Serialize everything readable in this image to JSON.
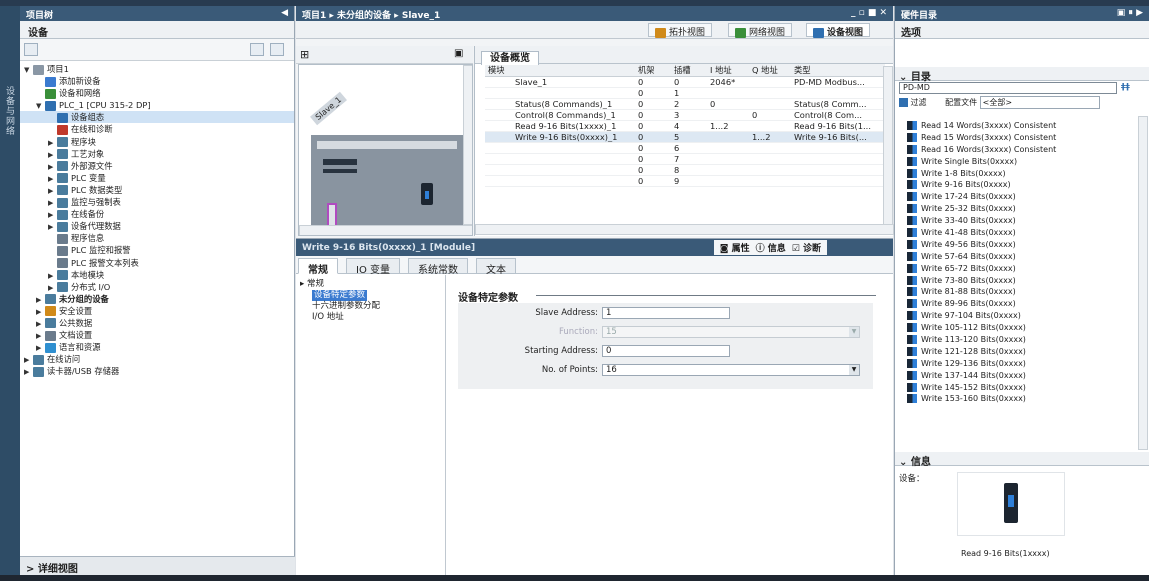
{
  "project_tree": {
    "panel_title": "项目树",
    "tab": "设备",
    "vertical_tab": "设备与网络",
    "items": [
      {
        "label": "项目1",
        "indent": 0,
        "arrow": "▼",
        "icon": "#8a97a5"
      },
      {
        "label": "添加新设备",
        "indent": 1,
        "arrow": "",
        "icon": "#3b7bd0"
      },
      {
        "label": "设备和网络",
        "indent": 1,
        "arrow": "",
        "icon": "#3a8f3a"
      },
      {
        "label": "PLC_1 [CPU 315-2 DP]",
        "indent": 1,
        "arrow": "▼",
        "icon": "#2f6fb0"
      },
      {
        "label": "设备组态",
        "indent": 2,
        "arrow": "",
        "icon": "#2f6fb0",
        "selected": true
      },
      {
        "label": "在线和诊断",
        "indent": 2,
        "arrow": "",
        "icon": "#c0392b"
      },
      {
        "label": "程序块",
        "indent": 2,
        "arrow": "▶",
        "icon": "#4a7c9d"
      },
      {
        "label": "工艺对象",
        "indent": 2,
        "arrow": "▶",
        "icon": "#4a7c9d"
      },
      {
        "label": "外部源文件",
        "indent": 2,
        "arrow": "▶",
        "icon": "#4a7c9d"
      },
      {
        "label": "PLC 变量",
        "indent": 2,
        "arrow": "▶",
        "icon": "#4a7c9d"
      },
      {
        "label": "PLC 数据类型",
        "indent": 2,
        "arrow": "▶",
        "icon": "#4a7c9d"
      },
      {
        "label": "监控与强制表",
        "indent": 2,
        "arrow": "▶",
        "icon": "#4a7c9d"
      },
      {
        "label": "在线备份",
        "indent": 2,
        "arrow": "▶",
        "icon": "#4a7c9d"
      },
      {
        "label": "设备代理数据",
        "indent": 2,
        "arrow": "▶",
        "icon": "#4a7c9d"
      },
      {
        "label": "程序信息",
        "indent": 2,
        "arrow": "",
        "icon": "#6a7b8c"
      },
      {
        "label": "PLC 监控和报警",
        "indent": 2,
        "arrow": "",
        "icon": "#6a7b8c"
      },
      {
        "label": "PLC 报警文本列表",
        "indent": 2,
        "arrow": "",
        "icon": "#6a7b8c"
      },
      {
        "label": "本地模块",
        "indent": 2,
        "arrow": "▶",
        "icon": "#4a7c9d"
      },
      {
        "label": "分布式 I/O",
        "indent": 2,
        "arrow": "▶",
        "icon": "#4a7c9d"
      },
      {
        "label": "未分组的设备",
        "indent": 1,
        "arrow": "▶",
        "icon": "#4a7c9d",
        "bold": true
      },
      {
        "label": "安全设置",
        "indent": 1,
        "arrow": "▶",
        "icon": "#d08a1a"
      },
      {
        "label": "公共数据",
        "indent": 1,
        "arrow": "▶",
        "icon": "#4a7c9d"
      },
      {
        "label": "文档设置",
        "indent": 1,
        "arrow": "▶",
        "icon": "#6a7b8c"
      },
      {
        "label": "语言和资源",
        "indent": 1,
        "arrow": "▶",
        "icon": "#2f8fd0"
      },
      {
        "label": "在线访问",
        "indent": 0,
        "arrow": "▶",
        "icon": "#4a7c9d"
      },
      {
        "label": "读卡器/USB 存储器",
        "indent": 0,
        "arrow": "▶",
        "icon": "#4a7c9d"
      }
    ],
    "details_view": "详细视图"
  },
  "editor": {
    "breadcrumb": "项目1 ▸ 未分组的设备 ▸ Slave_1",
    "views": {
      "topology": "拓扑视图",
      "network": "网络视图",
      "device": "设备视图"
    },
    "overview_tab": "设备概览",
    "device_label": "Slave_1",
    "table": {
      "headers": [
        "模块",
        "机架",
        "插槽",
        "I 地址",
        "Q 地址",
        "类型"
      ],
      "rows": [
        [
          "Slave_1",
          "0",
          "0",
          "2046*",
          "",
          "PD-MD Modbus..."
        ],
        [
          "",
          "0",
          "1",
          "",
          "",
          ""
        ],
        [
          "Status(8 Commands)_1",
          "0",
          "2",
          "0",
          "",
          "Status(8 Comm..."
        ],
        [
          "Control(8 Commands)_1",
          "0",
          "3",
          "",
          "0",
          "Control(8 Com..."
        ],
        [
          "Read 9-16 Bits(1xxxx)_1",
          "0",
          "4",
          "1...2",
          "",
          "Read 9-16 Bits(1..."
        ],
        [
          "Write 9-16 Bits(0xxxx)_1",
          "0",
          "5",
          "",
          "1...2",
          "Write 9-16 Bits(..."
        ],
        [
          "",
          "0",
          "6",
          "",
          "",
          ""
        ],
        [
          "",
          "0",
          "7",
          "",
          "",
          ""
        ],
        [
          "",
          "0",
          "8",
          "",
          "",
          ""
        ],
        [
          "",
          "0",
          "9",
          "",
          "",
          ""
        ]
      ]
    }
  },
  "inspector": {
    "title": "Write 9-16 Bits(0xxxx)_1 [Module]",
    "tabs_right": {
      "properties": "属性",
      "info": "信息",
      "diagnostics": "诊断"
    },
    "tabs": [
      "常规",
      "IO 变量",
      "系统常数",
      "文本"
    ],
    "nav": [
      "常规",
      "设备特定参数",
      "十六进制参数分配",
      "I/O 地址"
    ],
    "section_title": "设备特定参数",
    "fields": [
      {
        "label": "Slave Address:",
        "value": "1",
        "disabled": false,
        "dropdown": false
      },
      {
        "label": "Function:",
        "value": "15",
        "disabled": true,
        "dropdown": true
      },
      {
        "label": "Starting Address:",
        "value": "0",
        "disabled": false,
        "dropdown": false
      },
      {
        "label": "No. of Points:",
        "value": "16",
        "disabled": false,
        "dropdown": true
      }
    ]
  },
  "catalog": {
    "panel_title": "硬件目录",
    "options": "选项",
    "section": "目录",
    "search": "PD-MD",
    "filter_label": "过滤",
    "profile_label": "配置文件",
    "profile_value": "<全部>",
    "items": [
      "Read 14 Words(3xxxx) Consistent",
      "Read 15 Words(3xxxx) Consistent",
      "Read 16 Words(3xxxx) Consistent",
      "Write Single Bits(0xxxx)",
      "Write 1-8 Bits(0xxxx)",
      "Write 9-16 Bits(0xxxx)",
      "Write 17-24 Bits(0xxxx)",
      "Write 25-32 Bits(0xxxx)",
      "Write 33-40 Bits(0xxxx)",
      "Write 41-48 Bits(0xxxx)",
      "Write 49-56 Bits(0xxxx)",
      "Write 57-64 Bits(0xxxx)",
      "Write 65-72 Bits(0xxxx)",
      "Write 73-80 Bits(0xxxx)",
      "Write 81-88 Bits(0xxxx)",
      "Write 89-96 Bits(0xxxx)",
      "Write 97-104 Bits(0xxxx)",
      "Write 105-112 Bits(0xxxx)",
      "Write 113-120 Bits(0xxxx)",
      "Write 121-128 Bits(0xxxx)",
      "Write 129-136 Bits(0xxxx)",
      "Write 137-144 Bits(0xxxx)",
      "Write 145-152 Bits(0xxxx)",
      "Write 153-160 Bits(0xxxx)"
    ],
    "info_section": "信息",
    "info_device_label": "设备：",
    "info_caption": "Read 9-16 Bits(1xxxx)"
  }
}
